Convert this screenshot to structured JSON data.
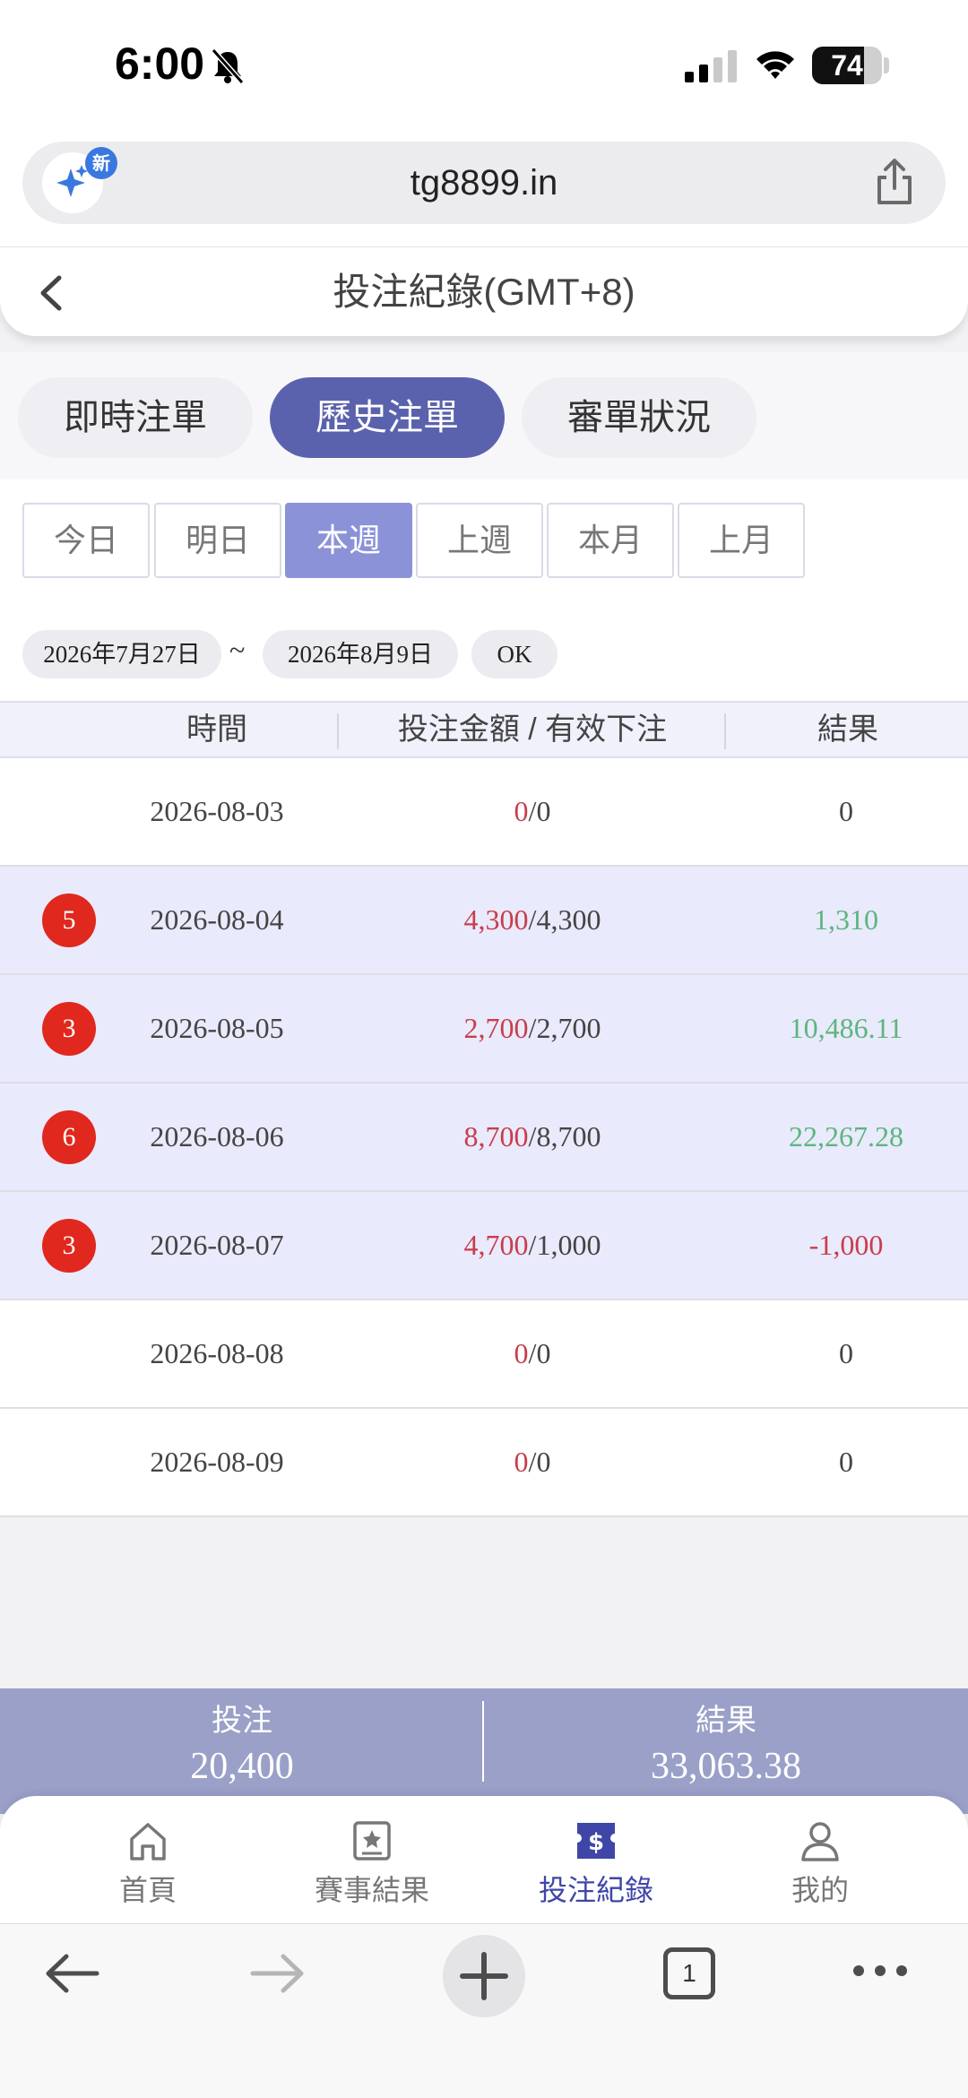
{
  "status_bar": {
    "time": "6:00",
    "battery": "74",
    "battery_level": 0.74
  },
  "browser": {
    "url": "tg8899.in",
    "new_badge": "新",
    "tab_count": "1"
  },
  "header": {
    "title": "投注紀錄(GMT+8)"
  },
  "tabs": [
    {
      "label": "即時注單",
      "active": false
    },
    {
      "label": "歷史注單",
      "active": true
    },
    {
      "label": "審單狀況",
      "active": false
    }
  ],
  "ranges": [
    {
      "label": "今日",
      "active": false
    },
    {
      "label": "明日",
      "active": false
    },
    {
      "label": "本週",
      "active": true
    },
    {
      "label": "上週",
      "active": false
    },
    {
      "label": "本月",
      "active": false
    },
    {
      "label": "上月",
      "active": false
    }
  ],
  "date_filter": {
    "start": "2026年7月27日",
    "separator": "~",
    "end": "2026年8月9日",
    "ok_label": "OK"
  },
  "table": {
    "headers": {
      "time": "時間",
      "amount": "投注金額 / 有效下注",
      "result": "結果"
    },
    "rows": [
      {
        "badge": "",
        "date": "2026-08-03",
        "bet": "0",
        "valid": "0",
        "result": "0",
        "result_type": "zero",
        "highlight": false
      },
      {
        "badge": "5",
        "date": "2026-08-04",
        "bet": "4,300",
        "valid": "4,300",
        "result": "1,310",
        "result_type": "pos",
        "highlight": true
      },
      {
        "badge": "3",
        "date": "2026-08-05",
        "bet": "2,700",
        "valid": "2,700",
        "result": "10,486.11",
        "result_type": "pos",
        "highlight": true
      },
      {
        "badge": "6",
        "date": "2026-08-06",
        "bet": "8,700",
        "valid": "8,700",
        "result": "22,267.28",
        "result_type": "pos",
        "highlight": true
      },
      {
        "badge": "3",
        "date": "2026-08-07",
        "bet": "4,700",
        "valid": "1,000",
        "result": "-1,000",
        "result_type": "neg",
        "highlight": true
      },
      {
        "badge": "",
        "date": "2026-08-08",
        "bet": "0",
        "valid": "0",
        "result": "0",
        "result_type": "zero",
        "highlight": false
      },
      {
        "badge": "",
        "date": "2026-08-09",
        "bet": "0",
        "valid": "0",
        "result": "0",
        "result_type": "zero",
        "highlight": false
      }
    ]
  },
  "summary": {
    "bet_label": "投注",
    "bet_value": "20,400",
    "result_label": "結果",
    "result_value": "33,063.38"
  },
  "bottom_nav": [
    {
      "label": "首頁",
      "icon": "home-icon",
      "active": false
    },
    {
      "label": "賽事結果",
      "icon": "star-board-icon",
      "active": false
    },
    {
      "label": "投注紀錄",
      "icon": "dollar-ticket-icon",
      "active": true
    },
    {
      "label": "我的",
      "icon": "user-icon",
      "active": false
    }
  ],
  "colors": {
    "accent": "#5b62ad",
    "range_active": "#8b92d7",
    "negative": "#c93d4c",
    "positive": "#5db57e",
    "badge": "#e0281e",
    "summary_bg": "#9aa0c8"
  }
}
